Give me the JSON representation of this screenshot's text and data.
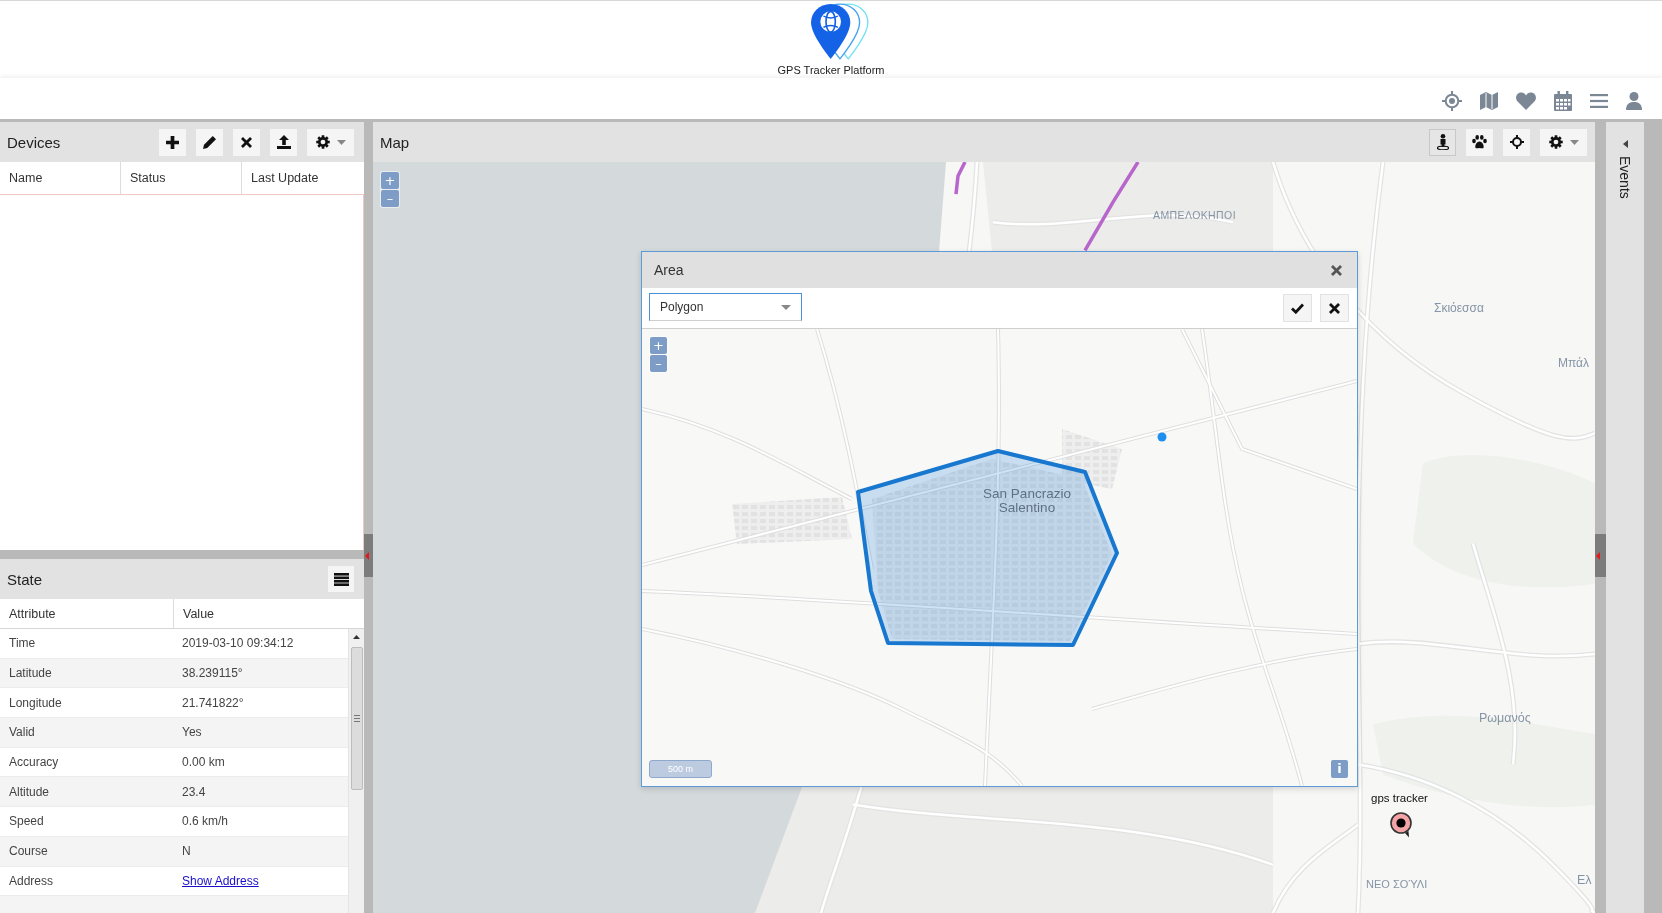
{
  "header": {
    "brand": "GPS Tracker Platform"
  },
  "devices": {
    "title": "Devices",
    "columns": [
      "Name",
      "Status",
      "Last Update"
    ]
  },
  "state": {
    "title": "State",
    "columns": [
      "Attribute",
      "Value"
    ],
    "rows": [
      {
        "kind": "text",
        "attribute": "Time",
        "value": "2019-03-10 09:34:12"
      },
      {
        "kind": "text",
        "attribute": "Latitude",
        "value": "38.239115°"
      },
      {
        "kind": "text",
        "attribute": "Longitude",
        "value": "21.741822°"
      },
      {
        "kind": "text",
        "attribute": "Valid",
        "value": "Yes"
      },
      {
        "kind": "text",
        "attribute": "Accuracy",
        "value": "0.00 km"
      },
      {
        "kind": "text",
        "attribute": "Altitude",
        "value": "23.4"
      },
      {
        "kind": "text",
        "attribute": "Speed",
        "value": "0.6 km/h"
      },
      {
        "kind": "text",
        "attribute": "Course",
        "value": "N"
      },
      {
        "kind": "link",
        "attribute": "Address",
        "value": "Show Address"
      }
    ]
  },
  "map": {
    "title": "Map",
    "toggle_button": {
      "pressed": true
    },
    "zoom_in": "+",
    "zoom_out": "–",
    "place_labels": [
      "ΑΜΠΕΛΟΚΗΠΟΙ",
      "Σκιόεσσα",
      "Μπάλ",
      "Ρωμανός",
      "ΝΕΟ ΣΟΎΛΙ",
      "Ελ"
    ],
    "marker": {
      "label": "gps tracker"
    }
  },
  "area_dialog": {
    "title": "Area",
    "type_field": {
      "value": "Polygon"
    },
    "zoom_in": "+",
    "zoom_out": "–",
    "place_label": "San Pancrazio Salentino",
    "scale": "500 m",
    "info_button": "i"
  },
  "events": {
    "title": "Events"
  }
}
